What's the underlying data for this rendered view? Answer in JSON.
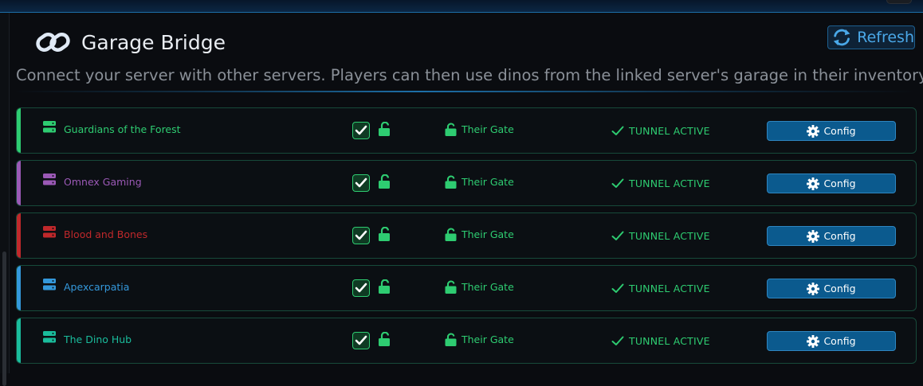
{
  "header": {
    "title": "Garage Bridge",
    "subtitle": "Connect your server with other servers. Players can then use dinos from the linked server's garage in their inventory.",
    "refresh_label": "Refresh"
  },
  "colors": {
    "accent_blue": "#1d6fa8",
    "active_green": "#2ecc71",
    "config_button": "#0b5a8e"
  },
  "servers": [
    {
      "name": "Guardians of the Forest",
      "color": "#2ecc71",
      "gate_label": "Their Gate",
      "status": "TUNNEL ACTIVE",
      "config_label": "Config",
      "enabled": true
    },
    {
      "name": "Omnex Gaming",
      "color": "#9b59b6",
      "gate_label": "Their Gate",
      "status": "TUNNEL ACTIVE",
      "config_label": "Config",
      "enabled": true
    },
    {
      "name": "Blood and Bones",
      "color": "#c0282b",
      "gate_label": "Their Gate",
      "status": "TUNNEL ACTIVE",
      "config_label": "Config",
      "enabled": true
    },
    {
      "name": "Apexcarpatia",
      "color": "#3498db",
      "gate_label": "Their Gate",
      "status": "TUNNEL ACTIVE",
      "config_label": "Config",
      "enabled": true
    },
    {
      "name": "The Dino Hub",
      "color": "#1abc9c",
      "gate_label": "Their Gate",
      "status": "TUNNEL ACTIVE",
      "config_label": "Config",
      "enabled": true
    }
  ]
}
